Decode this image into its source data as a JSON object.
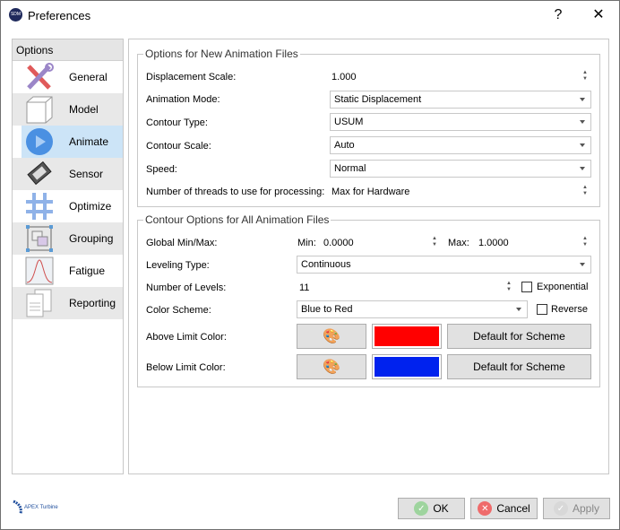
{
  "window": {
    "title": "Preferences",
    "help": "?",
    "close": "✕",
    "logo_text": "SDM"
  },
  "sidebar": {
    "header": "Options",
    "items": [
      {
        "label": "General",
        "icon": "tools-icon"
      },
      {
        "label": "Model",
        "icon": "cube-icon"
      },
      {
        "label": "Animate",
        "icon": "play-icon",
        "selected": true
      },
      {
        "label": "Sensor",
        "icon": "sensor-icon"
      },
      {
        "label": "Optimize",
        "icon": "grid-icon"
      },
      {
        "label": "Grouping",
        "icon": "grouping-icon"
      },
      {
        "label": "Fatigue",
        "icon": "bell-curve-icon"
      },
      {
        "label": "Reporting",
        "icon": "document-icon"
      }
    ]
  },
  "group1": {
    "title": "Options for New Animation Files",
    "displacement_scale": {
      "label": "Displacement Scale:",
      "value": "1.000"
    },
    "animation_mode": {
      "label": "Animation Mode:",
      "value": "Static Displacement"
    },
    "contour_type": {
      "label": "Contour Type:",
      "value": "USUM"
    },
    "contour_scale": {
      "label": "Contour Scale:",
      "value": "Auto"
    },
    "speed": {
      "label": "Speed:",
      "value": "Normal"
    },
    "threads": {
      "label": "Number of threads to use for processing:",
      "value": "Max for Hardware"
    }
  },
  "group2": {
    "title": "Contour Options for All Animation Files",
    "global": {
      "label": "Global Min/Max:",
      "min_label": "Min:",
      "min": "0.0000",
      "max_label": "Max:",
      "max": "1.0000"
    },
    "leveling": {
      "label": "Leveling Type:",
      "value": "Continuous"
    },
    "levels": {
      "label": "Number of Levels:",
      "value": "11",
      "exponential_label": "Exponential",
      "exponential": false
    },
    "scheme": {
      "label": "Color Scheme:",
      "value": "Blue to Red",
      "reverse_label": "Reverse",
      "reverse": false
    },
    "above": {
      "label": "Above Limit Color:",
      "color": "#ff0000",
      "default_label": "Default for Scheme"
    },
    "below": {
      "label": "Below Limit Color:",
      "color": "#0022ee",
      "default_label": "Default for Scheme"
    }
  },
  "footer": {
    "brand": "APEX Turbine",
    "ok": "OK",
    "cancel": "Cancel",
    "apply": "Apply"
  }
}
